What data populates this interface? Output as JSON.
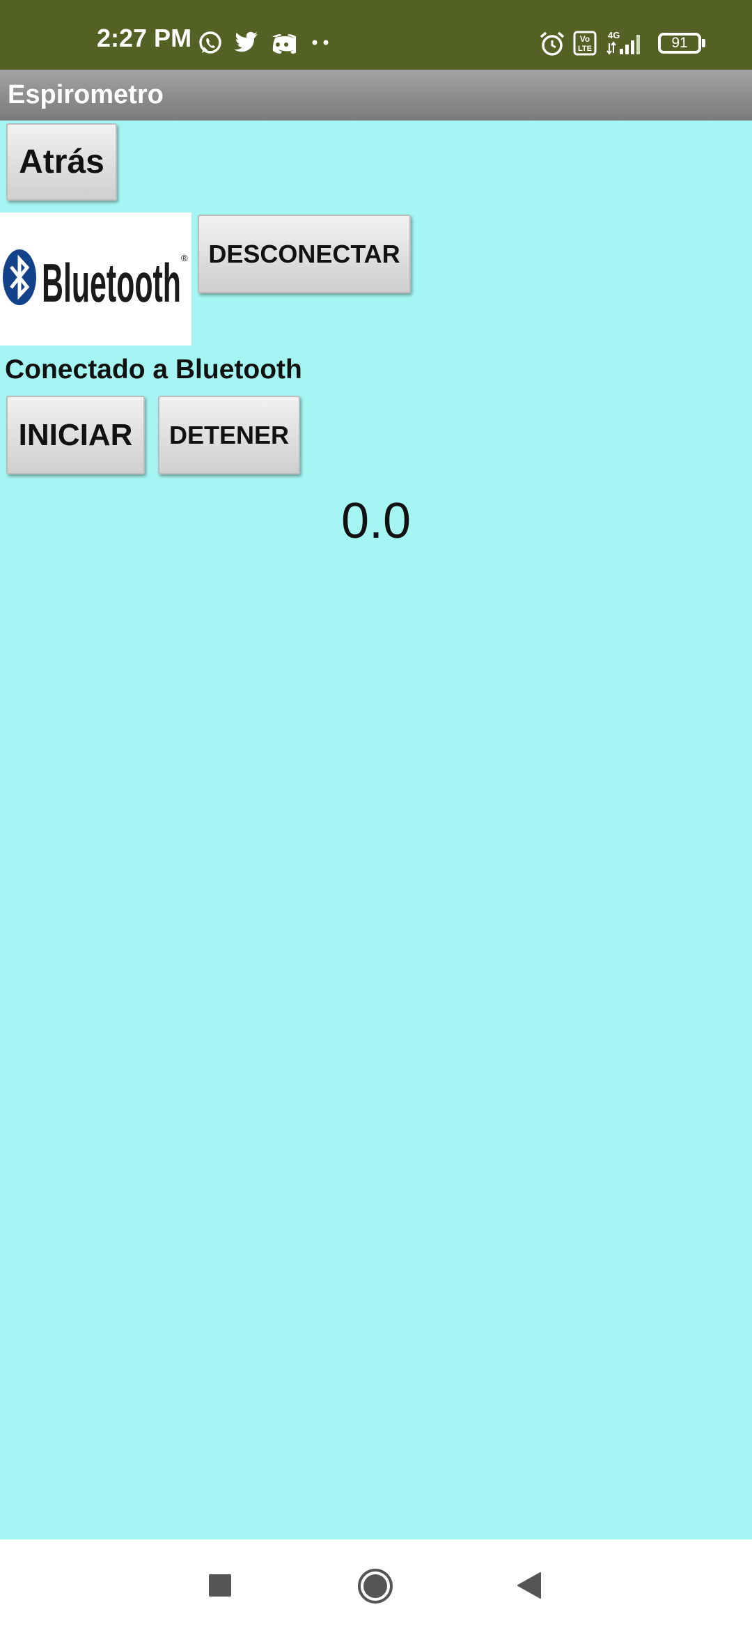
{
  "status_bar": {
    "time": "2:27 PM",
    "battery": "91",
    "notification_icons": [
      "whatsapp-icon",
      "twitter-icon",
      "discord-icon",
      "more-dots-icon"
    ],
    "system_icons": [
      "alarm-icon",
      "volte-icon",
      "signal-4g-icon",
      "battery-icon"
    ],
    "background_color": "#536224"
  },
  "app": {
    "title": "Espirometro",
    "background_color": "#a5f6f3"
  },
  "buttons": {
    "back_label": "Atrás",
    "disconnect_label": "DESCONECTAR",
    "start_label": "INICIAR",
    "stop_label": "DETENER"
  },
  "bluetooth_logo": {
    "wordmark": "Bluetooth",
    "registered_mark": "®"
  },
  "connection_status": "Conectado a Bluetooth",
  "reading_value": "0.0",
  "nav_bar": {
    "icons": [
      "recent-apps-icon",
      "home-icon",
      "back-icon"
    ]
  }
}
